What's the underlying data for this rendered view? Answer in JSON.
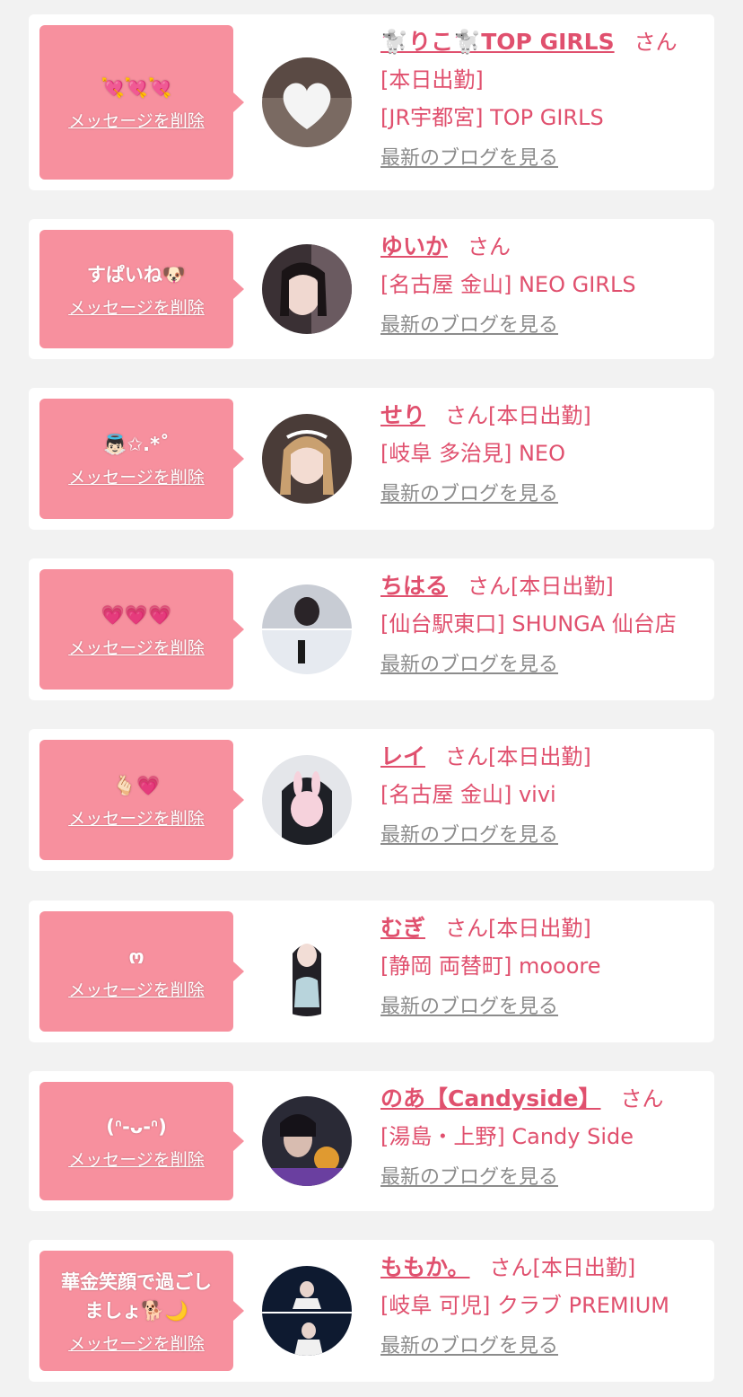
{
  "delete_label": "メッセージを削除",
  "blog_label": "最新のブログを見る",
  "san_label": "さん",
  "items": [
    {
      "message": "💘💘💘",
      "name": "🐩りこ🐩TOP GIRLS",
      "attendance": "[本日出勤]",
      "attendance_inline": "",
      "shop": "[JR宇都宮] TOP GIRLS",
      "avatar": "white-heart-avatar"
    },
    {
      "message": "すぱいね🐶",
      "name": "ゆいか",
      "attendance": "",
      "attendance_inline": "",
      "shop": "[名古屋 金山] NEO GIRLS",
      "avatar": "girl-selfie-avatar"
    },
    {
      "message": "👼🏻✩.*˚",
      "name": "せり",
      "attendance": "",
      "attendance_inline": "[本日出勤]",
      "shop": "[岐阜 多治見] NEO",
      "avatar": "girl-maid-avatar"
    },
    {
      "message": "💗💗💗",
      "name": "ちはる",
      "attendance": "",
      "attendance_inline": "[本日出勤]",
      "shop": "[仙台駅東口] SHUNGA 仙台店",
      "avatar": "snow-collage-avatar"
    },
    {
      "message": "🫰🏻💗",
      "name": "レイ",
      "attendance": "",
      "attendance_inline": "[本日出勤]",
      "shop": "[名古屋 金山] vivi",
      "avatar": "bunny-filter-avatar"
    },
    {
      "message": "ო",
      "name": "むぎ",
      "attendance": "",
      "attendance_inline": "[本日出勤]",
      "shop": "[静岡 両替町] mooore",
      "avatar": "girl-portrait-avatar"
    },
    {
      "message": "(ᐢ-ᴗ-ᐢ)",
      "name": "のあ【Candyside】",
      "attendance": "",
      "attendance_inline": "",
      "shop": "[湯島・上野] Candy Side",
      "avatar": "cat-selfie-avatar"
    },
    {
      "message": "華金笑顔で過ごし\nましょ🐕🌙",
      "name": "ももか。",
      "attendance": "",
      "attendance_inline": "[本日出勤]",
      "shop": "[岐阜 可児] クラブ PREMIUM",
      "avatar": "night-photo-avatar"
    }
  ],
  "colors": {
    "bubble": "#f7909e",
    "name": "#e0506e",
    "blog_link": "#8c8c8c",
    "background": "#f2f2f2"
  }
}
